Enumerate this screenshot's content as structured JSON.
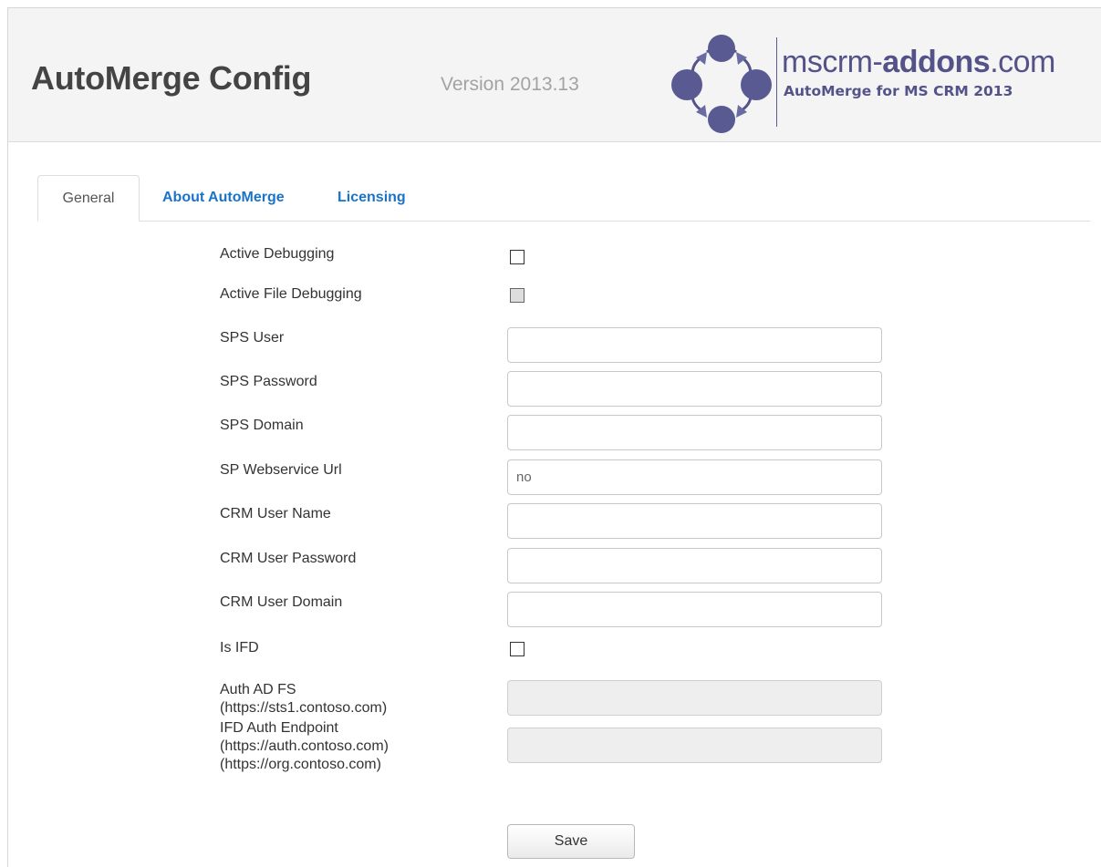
{
  "header": {
    "title": "AutoMerge Config",
    "version": "Version 2013.13",
    "logo_brand_prefix": "mscrm-",
    "logo_brand_bold": "addons",
    "logo_brand_suffix": ".com",
    "logo_subtitle": "AutoMerge for MS CRM 2013",
    "logo_icon": "circle-network-logo",
    "brand_color": "#53538a"
  },
  "tabs": [
    {
      "label": "General",
      "active": true
    },
    {
      "label": "About AutoMerge",
      "active": false
    },
    {
      "label": "Licensing",
      "active": false
    }
  ],
  "form": {
    "active_debugging": {
      "label": "Active Debugging",
      "checked": false
    },
    "active_file_debugging": {
      "label": "Active File Debugging",
      "checked": false,
      "disabled": true
    },
    "sps_user": {
      "label": "SPS User",
      "value": ""
    },
    "sps_password": {
      "label": "SPS Password",
      "value": ""
    },
    "sps_domain": {
      "label": "SPS Domain",
      "value": ""
    },
    "sp_webservice_url": {
      "label": "SP Webservice Url",
      "value": "no"
    },
    "crm_user_name": {
      "label": "CRM User Name",
      "value": ""
    },
    "crm_user_password": {
      "label": "CRM User Password",
      "value": ""
    },
    "crm_user_domain": {
      "label": "CRM User Domain",
      "value": ""
    },
    "is_ifd": {
      "label": "Is IFD",
      "checked": false
    },
    "auth_adfs": {
      "label_line1": "Auth AD FS",
      "label_line2": "(https://sts1.contoso.com)",
      "value": "",
      "disabled": true
    },
    "ifd_auth_endpoint": {
      "label_line1": "IFD Auth Endpoint",
      "label_line2": "(https://auth.contoso.com)",
      "label_line3": "(https://org.contoso.com)",
      "value": "",
      "disabled": true
    },
    "save_label": "Save"
  },
  "colors": {
    "link": "#1a73c8",
    "header_bg": "#f4f4f4"
  }
}
